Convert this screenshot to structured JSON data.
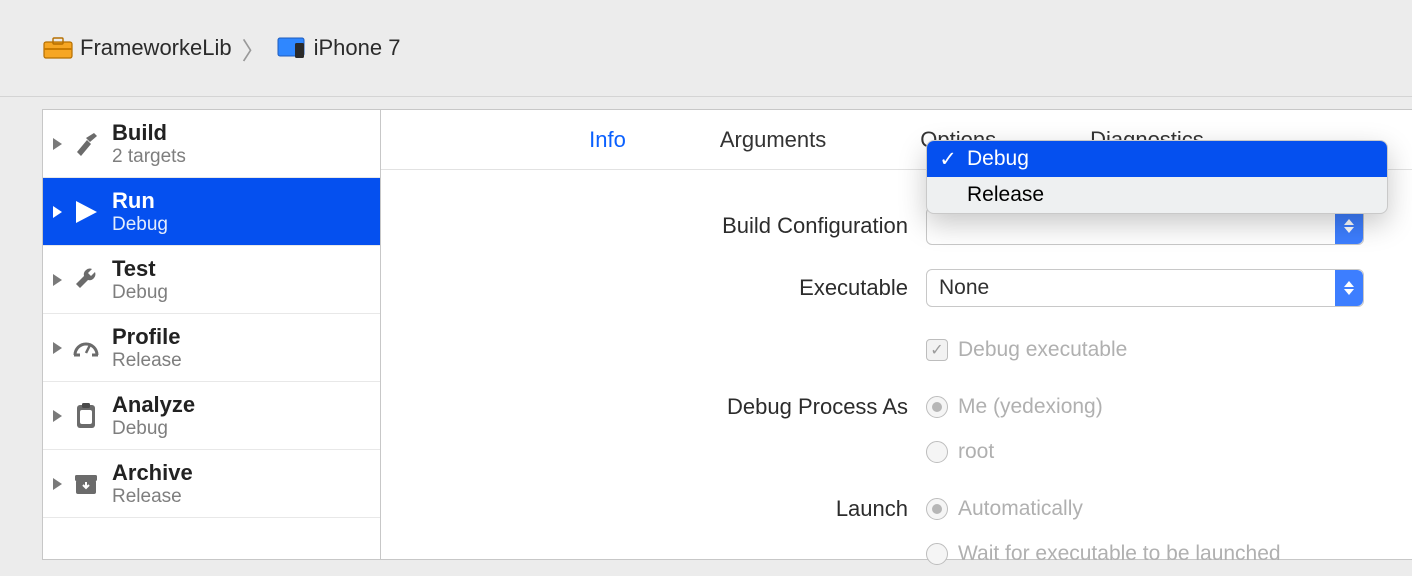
{
  "breadcrumb": {
    "project": "FrameworkeLib",
    "device": "iPhone 7"
  },
  "sidebar": {
    "items": [
      {
        "title": "Build",
        "subtitle": "2 targets"
      },
      {
        "title": "Run",
        "subtitle": "Debug"
      },
      {
        "title": "Test",
        "subtitle": "Debug"
      },
      {
        "title": "Profile",
        "subtitle": "Release"
      },
      {
        "title": "Analyze",
        "subtitle": "Debug"
      },
      {
        "title": "Archive",
        "subtitle": "Release"
      }
    ]
  },
  "tabs": {
    "info": "Info",
    "arguments": "Arguments",
    "options": "Options",
    "diagnostics": "Diagnostics"
  },
  "form": {
    "build_config_label": "Build Configuration",
    "executable_label": "Executable",
    "executable_value": "None",
    "debug_exec_label": "Debug executable",
    "debug_process_label": "Debug Process As",
    "me_label": "Me (yedexiong)",
    "root_label": "root",
    "launch_label": "Launch",
    "auto_label": "Automatically",
    "wait_label": "Wait for executable to be launched"
  },
  "dropdown": {
    "debug": "Debug",
    "release": "Release"
  }
}
